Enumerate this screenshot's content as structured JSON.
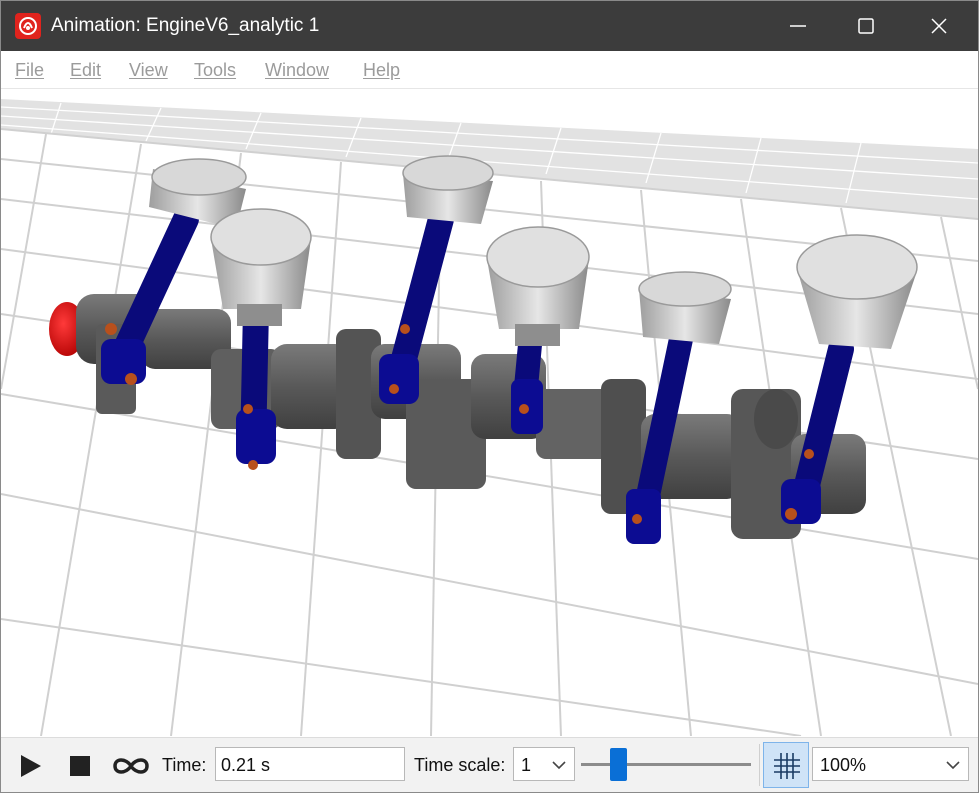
{
  "window": {
    "title": "Animation: EngineV6_analytic 1",
    "icon": "app-logo-icon",
    "controls": [
      "minimize-icon",
      "maximize-icon",
      "close-icon"
    ]
  },
  "menu": {
    "file": "File",
    "edit": "Edit",
    "view": "View",
    "tools": "Tools",
    "window": "Window",
    "help": "Help"
  },
  "viewport": {
    "content": "3d-engine-crankshaft-animation",
    "colors": {
      "pistons": "#d4d4d4",
      "rods": "#0b0b8a",
      "crankshaft": "#5e5e5e",
      "pulley": "#e01010",
      "grid": "#d2d2d2"
    }
  },
  "toolbar": {
    "play_icon": "play-icon",
    "stop_icon": "stop-icon",
    "loop_icon": "infinity-loop-icon",
    "time_label": "Time:",
    "time_value": "0.21 s",
    "time_scale_label": "Time scale:",
    "time_scale_value": "1",
    "slider_position": 0.2,
    "grid_icon": "grid-icon",
    "zoom_value": "100%"
  }
}
